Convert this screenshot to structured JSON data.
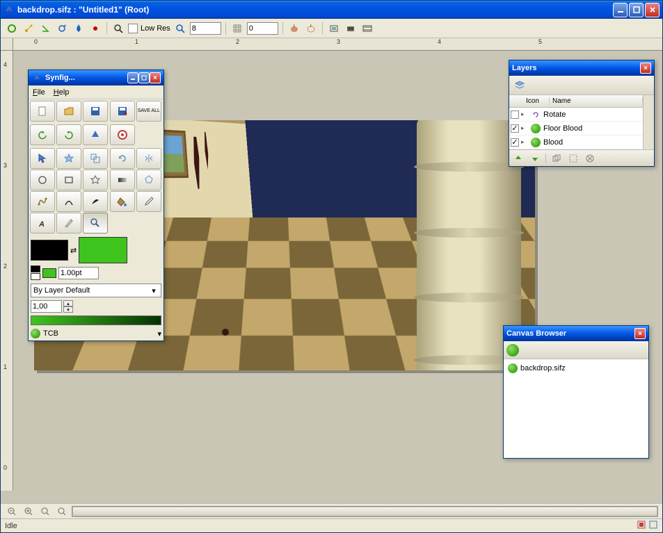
{
  "window": {
    "title": "backdrop.sifz : \"Untitled1\" (Root)",
    "min": "_",
    "max": "□",
    "close": "×"
  },
  "toolbar": {
    "lowres_label": "Low Res",
    "spin1": "8",
    "spin2": "0"
  },
  "status": {
    "text": "Idle"
  },
  "rulers_h": [
    "0",
    "1",
    "2",
    "3",
    "4",
    "5"
  ],
  "rulers_v": [
    "4",
    "3",
    "2",
    "1",
    "0"
  ],
  "toolbox": {
    "title": "Synfig...",
    "menu_file": "File",
    "menu_help": "Help",
    "save_all": "SAVE\nALL",
    "pt_value": "1.00pt",
    "blend_mode": "By Layer Default",
    "opacity": "1,00",
    "interp": "TCB"
  },
  "layers": {
    "title": "Layers",
    "col_icon": "Icon",
    "col_name": "Name",
    "items": [
      {
        "checked": false,
        "name": "Rotate",
        "icon": "rotate"
      },
      {
        "checked": true,
        "name": "Floor Blood",
        "icon": "green"
      },
      {
        "checked": true,
        "name": "Blood",
        "icon": "green"
      }
    ]
  },
  "canvas_browser": {
    "title": "Canvas Browser",
    "item": "backdrop.sifz"
  }
}
